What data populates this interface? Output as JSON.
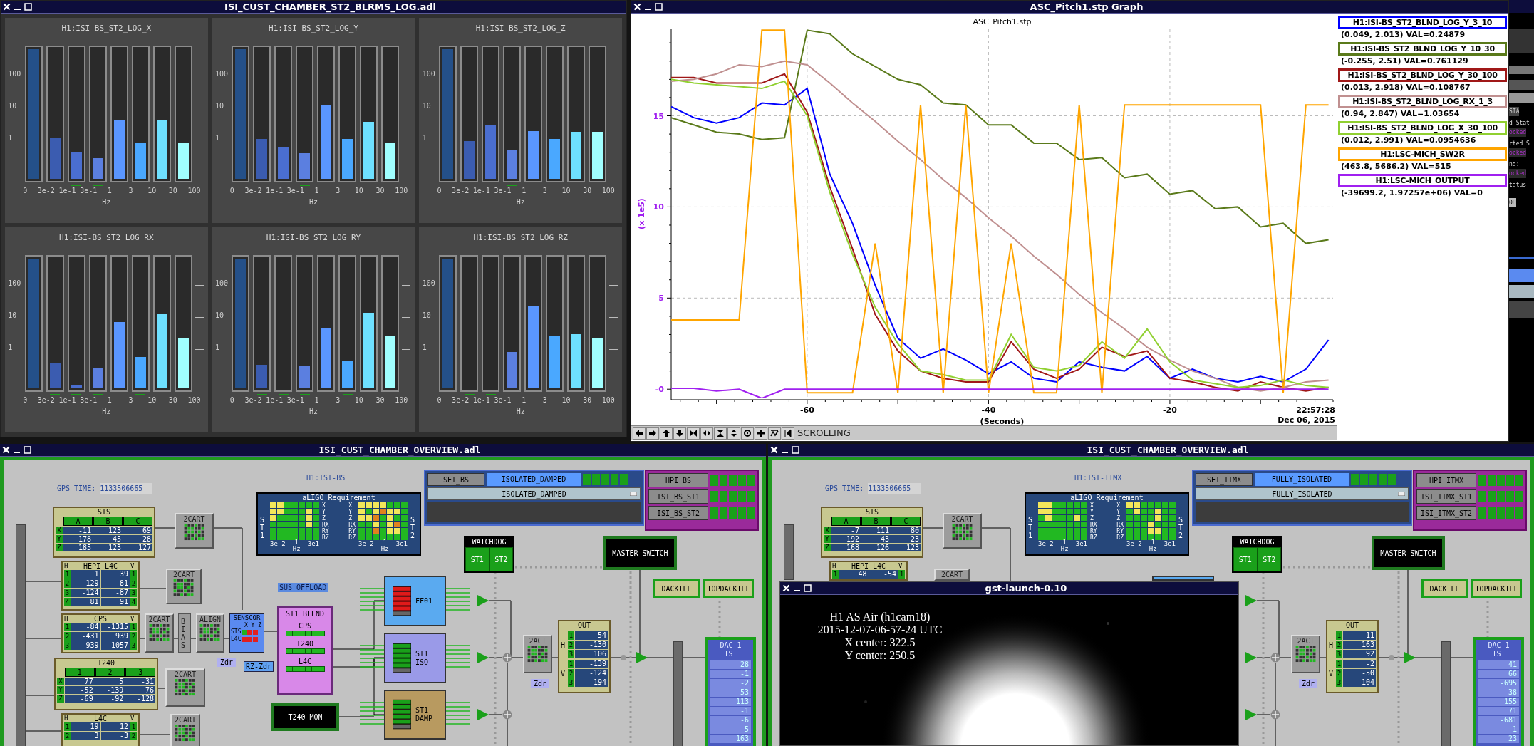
{
  "blrms_window": {
    "title": "ISI_CUST_CHAMBER_ST2_BLRMS_LOG.adl",
    "panels": [
      {
        "title": "H1:ISI-BS_ST2_LOG_X",
        "scale": [
          "100",
          "10",
          "1"
        ],
        "freqs": [
          "0",
          "3e-2",
          "1e-1",
          "3e-1",
          "1",
          "3",
          "10",
          "30",
          "100"
        ],
        "unit": "Hz",
        "bars": [
          {
            "level": 1,
            "color": "#245089",
            "marked": false
          },
          {
            "level": 0.32,
            "color": "#3b5cb0",
            "marked": false
          },
          {
            "level": 0.21,
            "color": "#4a6ed0",
            "marked": true
          },
          {
            "level": 0.16,
            "color": "#5b7fe0",
            "marked": true
          },
          {
            "level": 0.45,
            "color": "#5a96ff",
            "marked": false
          },
          {
            "level": 0.28,
            "color": "#4aa8ff",
            "marked": false
          },
          {
            "level": 0.45,
            "color": "#6ee0ff",
            "marked": false
          },
          {
            "level": 0.28,
            "color": "#a0ffff",
            "marked": false
          }
        ]
      },
      {
        "title": "H1:ISI-BS_ST2_LOG_Y",
        "scale": [
          "100",
          "10",
          "1"
        ],
        "freqs": [
          "0",
          "3e-2",
          "1e-1",
          "3e-1",
          "1",
          "3",
          "10",
          "30",
          "100"
        ],
        "unit": "Hz",
        "bars": [
          {
            "level": 1,
            "color": "#245089",
            "marked": false
          },
          {
            "level": 0.31,
            "color": "#3b5cb0",
            "marked": false
          },
          {
            "level": 0.25,
            "color": "#4a6ed0",
            "marked": false
          },
          {
            "level": 0.2,
            "color": "#5b7fe0",
            "marked": true
          },
          {
            "level": 0.57,
            "color": "#5a96ff",
            "marked": false
          },
          {
            "level": 0.31,
            "color": "#4aa8ff",
            "marked": false
          },
          {
            "level": 0.44,
            "color": "#6ee0ff",
            "marked": false
          },
          {
            "level": 0.28,
            "color": "#a0ffff",
            "marked": false
          }
        ]
      },
      {
        "title": "H1:ISI-BS_ST2_LOG_Z",
        "scale": [
          "100",
          "10",
          "1"
        ],
        "freqs": [
          "0",
          "3e-2",
          "1e-1",
          "3e-1",
          "1",
          "3",
          "10",
          "30",
          "100"
        ],
        "unit": "Hz",
        "bars": [
          {
            "level": 1,
            "color": "#245089",
            "marked": false
          },
          {
            "level": 0.29,
            "color": "#3b5cb0",
            "marked": false
          },
          {
            "level": 0.42,
            "color": "#4a6ed0",
            "marked": false
          },
          {
            "level": 0.22,
            "color": "#5b7fe0",
            "marked": true
          },
          {
            "level": 0.37,
            "color": "#5a96ff",
            "marked": false
          },
          {
            "level": 0.31,
            "color": "#4aa8ff",
            "marked": false
          },
          {
            "level": 0.36,
            "color": "#6ee0ff",
            "marked": false
          },
          {
            "level": 0.36,
            "color": "#a0ffff",
            "marked": false
          }
        ]
      },
      {
        "title": "H1:ISI-BS_ST2_LOG_RX",
        "scale": [
          "100",
          "10",
          "1"
        ],
        "freqs": [
          "0",
          "3e-2",
          "1e-1",
          "3e-1",
          "1",
          "3",
          "10",
          "30",
          "100"
        ],
        "unit": "Hz",
        "bars": [
          {
            "level": 1,
            "color": "#245089",
            "marked": false
          },
          {
            "level": 0.2,
            "color": "#3b5cb0",
            "marked": true
          },
          {
            "level": 0.02,
            "color": "#4a6ed0",
            "marked": true
          },
          {
            "level": 0.16,
            "color": "#5b7fe0",
            "marked": true
          },
          {
            "level": 0.51,
            "color": "#5a96ff",
            "marked": false
          },
          {
            "level": 0.24,
            "color": "#4aa8ff",
            "marked": true
          },
          {
            "level": 0.57,
            "color": "#6ee0ff",
            "marked": false
          },
          {
            "level": 0.39,
            "color": "#a0ffff",
            "marked": false
          }
        ]
      },
      {
        "title": "H1:ISI-BS_ST2_LOG_RY",
        "scale": [
          "100",
          "10",
          "1"
        ],
        "freqs": [
          "0",
          "3e-2",
          "1e-1",
          "3e-1",
          "1",
          "3",
          "10",
          "30",
          "100"
        ],
        "unit": "Hz",
        "bars": [
          {
            "level": 1,
            "color": "#245089",
            "marked": false
          },
          {
            "level": 0.18,
            "color": "#3b5cb0",
            "marked": true
          },
          {
            "marked": true
          },
          {
            "level": 0.17,
            "color": "#5b7fe0",
            "marked": true
          },
          {
            "level": 0.46,
            "color": "#5a96ff",
            "marked": false
          },
          {
            "level": 0.21,
            "color": "#4aa8ff",
            "marked": true
          },
          {
            "level": 0.58,
            "color": "#6ee0ff",
            "marked": false
          },
          {
            "level": 0.4,
            "color": "#a0ffff",
            "marked": false
          }
        ]
      },
      {
        "title": "H1:ISI-BS_ST2_LOG_RZ",
        "scale": [
          "100",
          "10",
          "1"
        ],
        "freqs": [
          "0",
          "3e-2",
          "1e-1",
          "3e-1",
          "1",
          "3",
          "10",
          "30",
          "100"
        ],
        "unit": "Hz",
        "bars": [
          {
            "level": 1,
            "color": "#245089",
            "marked": false
          },
          {
            "marked": true
          },
          {
            "marked": true
          },
          {
            "level": 0.28,
            "color": "#5b7fe0",
            "marked": false
          },
          {
            "level": 0.63,
            "color": "#5a96ff",
            "marked": false
          },
          {
            "level": 0.4,
            "color": "#4aa8ff",
            "marked": false
          },
          {
            "level": 0.42,
            "color": "#6ee0ff",
            "marked": false
          },
          {
            "level": 0.39,
            "color": "#a0ffff",
            "marked": false
          }
        ]
      }
    ]
  },
  "graph_window": {
    "title": "ASC_Pitch1.stp Graph",
    "time": "22:57:28",
    "date": "Dec 06, 2015",
    "mode": "SCROLLING",
    "chart_data": {
      "type": "line",
      "title": "ASC_Pitch1.stp",
      "xlabel": "(Seconds)",
      "ylabel": "(x 1e5)",
      "xlim": [
        -75,
        -2
      ],
      "ylim": [
        -0.5,
        19.75
      ],
      "grid": true,
      "xticks": [
        -60,
        -40,
        -20
      ],
      "yticks": [
        {
          "value": 0,
          "label": "-0"
        },
        5,
        10,
        15
      ],
      "x": [
        -75,
        -72.5,
        -70,
        -67.5,
        -65,
        -62.5,
        -60,
        -57.5,
        -55,
        -52.5,
        -50,
        -47.5,
        -45,
        -42.5,
        -40,
        -37.5,
        -35,
        -32.5,
        -30,
        -27.5,
        -25,
        -22.5,
        -20,
        -17.5,
        -15,
        -12.5,
        -10,
        -7.5,
        -5,
        -2.5
      ],
      "series": [
        {
          "name": "H1:ISI-BS_ST2_BLND_LOG_Y_3_10",
          "color": "#0000ff",
          "values": [
            15.5,
            14.9,
            14.6,
            14.9,
            15.7,
            15.6,
            16.5,
            11.8,
            9.1,
            5.7,
            2.8,
            1.7,
            2.2,
            1.6,
            0.85,
            1.5,
            0.6,
            0.4,
            1.5,
            1.2,
            1.0,
            1.8,
            0.6,
            1.1,
            0.6,
            0.4,
            0.7,
            0.4,
            1.1,
            2.7
          ]
        },
        {
          "name": "H1:ISI-BS_ST2_BLND_LOG_Y_10_30",
          "color": "#5a7a1a",
          "values": [
            14.9,
            14.5,
            14.1,
            14.0,
            13.7,
            13.8,
            19.7,
            19.5,
            18.4,
            17.7,
            17.0,
            16.7,
            15.7,
            15.6,
            14.5,
            14.5,
            13.5,
            13.5,
            12.6,
            12.7,
            11.6,
            11.8,
            10.7,
            10.9,
            9.9,
            10.0,
            8.9,
            9.1,
            8.0,
            8.2
          ]
        },
        {
          "name": "H1:ISI-BS_ST2_BLND_LOG_Y_30_100",
          "color": "#a01818",
          "values": [
            17.1,
            17.1,
            16.8,
            16.8,
            16.8,
            17.3,
            15.2,
            11.1,
            7.7,
            4.1,
            2.1,
            1.0,
            0.6,
            0.4,
            0.4,
            2.6,
            1.1,
            0.6,
            1.1,
            2.3,
            1.8,
            2.1,
            0.6,
            0.4,
            0.1,
            -0.1,
            0.4,
            0.1,
            -0.1,
            0.1
          ]
        },
        {
          "name": "H1:ISI-BS_ST2_BLND_LOG_RX_1_3",
          "color": "#c09090",
          "values": [
            16.9,
            17.0,
            17.3,
            17.8,
            17.7,
            18.0,
            17.8,
            16.8,
            15.7,
            14.7,
            13.6,
            12.6,
            11.5,
            10.5,
            9.4,
            8.4,
            7.3,
            6.3,
            5.2,
            4.2,
            3.3,
            2.3,
            1.6,
            1.0,
            0.6,
            0.1,
            -0.1,
            0.1,
            0.4,
            0.5
          ]
        },
        {
          "name": "H1:ISI-BS_ST2_BLND_LOG_X_30_100",
          "color": "#90d030",
          "values": [
            17.0,
            16.8,
            16.7,
            16.6,
            16.5,
            16.9,
            15.0,
            10.8,
            7.4,
            4.5,
            2.5,
            1.0,
            0.8,
            0.5,
            0.5,
            3.0,
            1.2,
            1.0,
            1.3,
            2.6,
            1.7,
            3.3,
            1.5,
            0.5,
            0.3,
            0.1,
            0.2,
            0.5,
            0.2,
            0.1
          ]
        },
        {
          "name": "H1:LSC-MICH_SW2R",
          "color": "#ffa500",
          "values": [
            3.8,
            3.8,
            3.8,
            3.8,
            19.7,
            19.7,
            -0.2,
            -0.2,
            -0.2,
            8,
            -0.2,
            15.6,
            -0.2,
            15.6,
            -0.2,
            8,
            -0.2,
            -0.2,
            15.6,
            -0.2,
            15.6,
            15.6,
            15.6,
            15.6,
            15.6,
            15.6,
            15.6,
            -0.2,
            15.6,
            15.6
          ]
        },
        {
          "name": "H1:LSC-MICH_OUTPUT",
          "color": "#a020f0",
          "values": [
            0.05,
            0.05,
            -0.1,
            0,
            -0.5,
            0,
            0,
            0,
            0,
            0,
            0,
            0,
            0,
            0,
            0,
            0,
            0,
            0,
            0,
            0,
            0,
            0,
            0,
            0,
            0,
            0,
            0,
            0,
            0,
            0
          ]
        }
      ]
    },
    "readings": [
      "(0.049, 2.013) VAL=0.24879",
      "(-0.255, 2.51) VAL=0.761129",
      "(0.013, 2.918) VAL=0.108767",
      "(0.94, 2.847) VAL=1.03654",
      "(0.012, 2.991) VAL=0.0954636",
      "(463.8, 5686.2) VAL=515",
      "(-39699.2, 1.97257e+06) VAL=0"
    ]
  },
  "background_window": {
    "fragments": [
      {
        "text": "STA",
        "kind": "heading"
      },
      {
        "text": "d Stat",
        "kind": "label"
      },
      {
        "text": "ocked",
        "kind": "status"
      },
      {
        "text": "rted S",
        "kind": "label"
      },
      {
        "text": "ocked",
        "kind": "status"
      },
      {
        "text": "nd:",
        "kind": "label"
      },
      {
        "text": "ocked",
        "kind": "status"
      },
      {
        "text": "tatus",
        "kind": "label"
      },
      {
        "text": "0H",
        "kind": "field"
      }
    ]
  },
  "overview_windows": [
    {
      "title": "ISI_CUST_CHAMBER_OVERVIEW.adl",
      "gps_label": "GPS TIME:",
      "gps_time": "1133506665",
      "chamber": "H1:ISI-BS",
      "sts": {
        "title": "STS",
        "columns": [
          "A",
          "B",
          "C"
        ],
        "rows": [
          {
            "label": "X",
            "values": [
              "-11",
              "123",
              "69"
            ]
          },
          {
            "label": "Y",
            "values": [
              "178",
              "45",
              "28"
            ]
          },
          {
            "label": "Z",
            "values": [
              "185",
              "123",
              "127"
            ]
          }
        ]
      },
      "carts": [
        "2CART",
        "2CART",
        "2CART",
        "2CART",
        "2CART"
      ],
      "hepi": {
        "title": "HEPI L4C",
        "left": "H",
        "right": "V",
        "rows": [
          [
            "1",
            "1",
            "39",
            "1"
          ],
          [
            "2",
            "-129",
            "-81",
            "2"
          ],
          [
            "3",
            "-124",
            "-87",
            "3"
          ],
          [
            "4",
            "81",
            "91",
            "4"
          ]
        ]
      },
      "cps": {
        "title": "CPS",
        "left": "H",
        "right": "V",
        "rows": [
          [
            "1",
            "-84",
            "-1315",
            "1"
          ],
          [
            "2",
            "-431",
            "939",
            "2"
          ],
          [
            "3",
            "-939",
            "-1057",
            "3"
          ]
        ]
      },
      "bias": "BIAS",
      "align": "ALIGN",
      "senscor": {
        "title": "SENSCOR",
        "axes": "X Y Z",
        "rows": [
          {
            "label": "STS",
            "cells": [
              {
                "color": "#20b020"
              },
              {
                "color": "#e02020"
              },
              {
                "color": "#e02020"
              }
            ]
          },
          {
            "label": "L4C",
            "cells": [
              {
                "color": "#e02020"
              },
              {
                "color": "#e02020"
              },
              {
                "color": "#e02020"
              }
            ]
          }
        ]
      },
      "t240": {
        "title": "T240",
        "columns": [
          "1",
          "2",
          "3"
        ],
        "rows": [
          {
            "label": "X",
            "values": [
              "77",
              "5",
              "-31"
            ]
          },
          {
            "label": "Y",
            "values": [
              "-52",
              "-139",
              "76"
            ]
          },
          {
            "label": "Z",
            "values": [
              "-69",
              "-92",
              "-128"
            ]
          }
        ]
      },
      "l4c": {
        "title": "L4C",
        "left": "H",
        "right": "V",
        "rows": [
          [
            "1",
            "-19",
            "12",
            "1"
          ],
          [
            "2",
            "3",
            "-3",
            "2"
          ]
        ]
      },
      "tags": [
        "Zdr",
        "RZ-Zdr"
      ],
      "sus_offload": "SUS OFFLOAD",
      "blend": {
        "title": "ST1 BLEND",
        "rows": [
          "CPS",
          "T240",
          "L4C"
        ]
      },
      "t240_mon": "T240 MON",
      "requirement": {
        "title": "aLIGO Requirement",
        "grids": [
          {
            "stage": "ST1",
            "dofs": [
              "X",
              "Y",
              "Z",
              "RX",
              "RY",
              "RZ"
            ],
            "ticks": [
              "3e-2",
              "1",
              "Hz",
              "3e1"
            ],
            "cells": [
              [
                {
                  "color": "#f2e65a"
                },
                {
                  "color": "#f2e65a"
                },
                {
                  "color": "#22b822"
                },
                {
                  "color": "#22b822"
                },
                {
                  "color": "#22b822"
                },
                {
                  "color": "#22b822"
                },
                {
                  "color": "#22b822"
                }
              ],
              [
                {
                  "color": "#f2e65a"
                },
                {
                  "color": "#f2e65a"
                },
                {
                  "color": "#22b822"
                },
                {
                  "color": "#22b822"
                },
                {
                  "color": "#22b822"
                },
                {
                  "color": "#f2e65a"
                },
                {
                  "color": "#22b822"
                }
              ],
              [
                {
                  "color": "#f2e65a"
                },
                {
                  "color": "#22b822"
                },
                {
                  "color": "#22b822"
                },
                {
                  "color": "#22b822"
                },
                {
                  "color": "#22b822"
                },
                {
                  "color": "#f2e65a"
                },
                {
                  "color": "#22b822"
                }
              ],
              [
                {
                  "color": "#22b822"
                },
                {
                  "color": "#22b822"
                },
                {
                  "color": "#22b822"
                },
                {
                  "color": "#22b822"
                },
                {
                  "color": "#22b822"
                },
                {
                  "color": "#f2e65a"
                },
                {
                  "color": "#22b822"
                }
              ],
              [
                {
                  "color": "#22b822"
                },
                {
                  "color": "#22b822"
                },
                {
                  "color": "#22b822"
                },
                {
                  "color": "#22b822"
                },
                {
                  "color": "#22b822"
                },
                {
                  "color": "#22b822"
                },
                {
                  "color": "#22b822"
                }
              ],
              [
                {
                  "color": "#22b822"
                },
                {
                  "color": "#22b822"
                },
                {
                  "color": "#22b822"
                },
                {
                  "color": "#22b822"
                },
                {
                  "color": "#22b822"
                },
                {
                  "color": "#22b822"
                },
                {
                  "color": "#22b822"
                }
              ]
            ]
          },
          {
            "stage": "ST2",
            "dofs": [
              "X",
              "Y",
              "Z",
              "RX",
              "RY",
              "RZ"
            ],
            "ticks": [
              "3e-2",
              "1",
              "Hz",
              "3e1"
            ],
            "cells": [
              [
                {
                  "color": "#f2e65a"
                },
                {
                  "color": "#f2e65a"
                },
                {
                  "color": "#f2e65a"
                },
                {
                  "color": "#f2e65a"
                },
                {
                  "color": "#22b822"
                },
                {
                  "color": "#22b822"
                },
                {
                  "color": "#22b822"
                }
              ],
              [
                {
                  "color": "#f2e65a"
                },
                {
                  "color": "#22b822"
                },
                {
                  "color": "#f2e65a"
                },
                {
                  "color": "#e0821e"
                },
                {
                  "color": "#f2e65a"
                },
                {
                  "color": "#f2e65a"
                },
                {
                  "color": "#22b822"
                }
              ],
              [
                {
                  "color": "#f2e65a"
                },
                {
                  "color": "#f2e65a"
                },
                {
                  "color": "#e0821e"
                },
                {
                  "color": "#22b822"
                },
                {
                  "color": "#f2e65a"
                },
                {
                  "color": "#22b822"
                },
                {
                  "color": "#22b822"
                }
              ],
              [
                {
                  "color": "#22b822"
                },
                {
                  "color": "#22b822"
                },
                {
                  "color": "#f2e65a"
                },
                {
                  "color": "#22b822"
                },
                {
                  "color": "#f2e65a"
                },
                {
                  "color": "#e0821e"
                },
                {
                  "color": "#22b822"
                }
              ],
              [
                {
                  "color": "#22b822"
                },
                {
                  "color": "#22b822"
                },
                {
                  "color": "#e0821e"
                },
                {
                  "color": "#22b822"
                },
                {
                  "color": "#f2e65a"
                },
                {
                  "color": "#f2e65a"
                },
                {
                  "color": "#22b822"
                }
              ],
              [
                {
                  "color": "#22b822"
                },
                {
                  "color": "#22b822"
                },
                {
                  "color": "#22b822"
                },
                {
                  "color": "#22b822"
                },
                {
                  "color": "#22b822"
                },
                {
                  "color": "#22b822"
                },
                {
                  "color": "#22b822"
                }
              ]
            ]
          }
        ]
      },
      "guardian": {
        "node": "SEI_BS",
        "state": "ISOLATED_DAMPED",
        "lights": [
          {
            "color": "#1aa01a"
          },
          {
            "color": "#1aa01a"
          },
          {
            "color": "#1aa01a"
          },
          {
            "color": "#1aa01a"
          },
          {
            "color": "#1aa01a"
          }
        ],
        "request": "ISOLATED_DAMPED"
      },
      "subsystems": [
        {
          "label": "HPI_BS",
          "lights": [
            {
              "color": "#1aa01a"
            },
            {
              "color": "#1aa01a"
            },
            {
              "color": "#1aa01a"
            },
            {
              "color": "#1aa01a"
            },
            {
              "color": "#1aa01a"
            }
          ]
        },
        {
          "label": "ISI_BS_ST1",
          "lights": [
            {
              "color": "#1aa01a"
            },
            {
              "color": "#1aa01a"
            },
            {
              "color": "#1aa01a"
            },
            {
              "color": "#1aa01a"
            },
            {
              "color": "#1aa01a"
            }
          ]
        },
        {
          "label": "ISI_BS_ST2",
          "lights": [
            {
              "color": "#1aa01a"
            },
            {
              "color": "#1aa01a"
            },
            {
              "color": "#1aa01a"
            },
            {
              "color": "#1aa01a"
            },
            {
              "color": "#1aa01a"
            }
          ]
        }
      ],
      "watchdog": {
        "title": "WATCHDOG",
        "stages": [
          "ST1",
          "ST2"
        ]
      },
      "master_switch": "MASTER SWITCH",
      "kill_buttons": [
        "DACKILL",
        "IOPDACKILL"
      ],
      "filters": [
        {
          "kind": "ff",
          "label": "FF01"
        },
        {
          "kind": "iso",
          "label": "ST1 ISO"
        },
        {
          "kind": "damp",
          "label": "ST1 DAMP"
        }
      ],
      "act": "2ACT",
      "act_tag": "Zdr",
      "out": {
        "title": "OUT",
        "groups": [
          {
            "label": "H",
            "rows": [
              [
                "1",
                "-54"
              ],
              [
                "2",
                "-130"
              ],
              [
                "3",
                "106"
              ]
            ]
          },
          {
            "label": "V",
            "rows": [
              [
                "1",
                "-139"
              ],
              [
                "2",
                "-124"
              ],
              [
                "3",
                "-194"
              ]
            ]
          }
        ]
      },
      "dac": {
        "title": "DAC 1",
        "subtitle": "ISI",
        "values": [
          "28",
          "-1",
          "-2",
          "-53",
          "113",
          "-1",
          "-6",
          "5",
          "163"
        ]
      }
    },
    {
      "title": "ISI_CUST_CHAMBER_OVERVIEW.adl",
      "gps_label": "GPS TIME:",
      "gps_time": "1133506665",
      "chamber": "H1:ISI-ITMX",
      "sts": {
        "title": "STS",
        "columns": [
          "A",
          "B",
          "C"
        ],
        "rows": [
          {
            "label": "X",
            "values": [
              "-7",
              "111",
              "80"
            ]
          },
          {
            "label": "Y",
            "values": [
              "192",
              "43",
              "23"
            ]
          },
          {
            "label": "Z",
            "values": [
              "168",
              "126",
              "123"
            ]
          }
        ]
      },
      "carts": [
        "2CART",
        "2CART"
      ],
      "hepi": {
        "title": "HEPI L4C",
        "left": "H",
        "right": "V",
        "rows": [
          [
            "1",
            "48",
            "-54",
            "1"
          ]
        ]
      },
      "requirement": {
        "title": "aLIGO Requirement",
        "grids": [
          {
            "stage": "ST1",
            "dofs": [
              "X",
              "Y",
              "Z",
              "RX",
              "RY",
              "RZ"
            ],
            "ticks": [
              "3e-2",
              "1",
              "Hz",
              "3e1"
            ],
            "cells": [
              [
                {
                  "color": "#f2e65a"
                },
                {
                  "color": "#f2e65a"
                },
                {
                  "color": "#22b822"
                },
                {
                  "color": "#22b822"
                },
                {
                  "color": "#22b822"
                },
                {
                  "color": "#22b822"
                },
                {
                  "color": "#22b822"
                }
              ],
              [
                {
                  "color": "#f2e65a"
                },
                {
                  "color": "#f2e65a"
                },
                {
                  "color": "#22b822"
                },
                {
                  "color": "#22b822"
                },
                {
                  "color": "#22b822"
                },
                {
                  "color": "#22b822"
                },
                {
                  "color": "#22b822"
                }
              ],
              [
                {
                  "color": "#22b822"
                },
                {
                  "color": "#f2e65a"
                },
                {
                  "color": "#22b822"
                },
                {
                  "color": "#22b822"
                },
                {
                  "color": "#22b822"
                },
                {
                  "color": "#f2e65a"
                },
                {
                  "color": "#22b822"
                }
              ],
              [
                {
                  "color": "#22b822"
                },
                {
                  "color": "#22b822"
                },
                {
                  "color": "#22b822"
                },
                {
                  "color": "#22b822"
                },
                {
                  "color": "#22b822"
                },
                {
                  "color": "#22b822"
                },
                {
                  "color": "#22b822"
                }
              ],
              [
                {
                  "color": "#22b822"
                },
                {
                  "color": "#22b822"
                },
                {
                  "color": "#22b822"
                },
                {
                  "color": "#22b822"
                },
                {
                  "color": "#22b822"
                },
                {
                  "color": "#22b822"
                },
                {
                  "color": "#22b822"
                }
              ],
              [
                {
                  "color": "#22b822"
                },
                {
                  "color": "#22b822"
                },
                {
                  "color": "#22b822"
                },
                {
                  "color": "#22b822"
                },
                {
                  "color": "#22b822"
                },
                {
                  "color": "#22b822"
                },
                {
                  "color": "#22b822"
                }
              ]
            ]
          },
          {
            "stage": "ST2",
            "dofs": [
              "X",
              "Y",
              "Z",
              "RX",
              "RY",
              "RZ"
            ],
            "ticks": [
              "3e-2",
              "1",
              "Hz",
              "3e1"
            ],
            "cells": [
              [
                {
                  "color": "#f2e65a"
                },
                {
                  "color": "#f2e65a"
                },
                {
                  "color": "#22b822"
                },
                {
                  "color": "#22b822"
                },
                {
                  "color": "#22b822"
                },
                {
                  "color": "#22b822"
                },
                {
                  "color": "#22b822"
                }
              ],
              [
                {
                  "color": "#22b822"
                },
                {
                  "color": "#f2e65a"
                },
                {
                  "color": "#22b822"
                },
                {
                  "color": "#22b822"
                },
                {
                  "color": "#f2e65a"
                },
                {
                  "color": "#22b822"
                },
                {
                  "color": "#22b822"
                }
              ],
              [
                {
                  "color": "#22b822"
                },
                {
                  "color": "#22b822"
                },
                {
                  "color": "#22b822"
                },
                {
                  "color": "#22b822"
                },
                {
                  "color": "#f2e65a"
                },
                {
                  "color": "#22b822"
                },
                {
                  "color": "#22b822"
                }
              ],
              [
                {
                  "color": "#22b822"
                },
                {
                  "color": "#22b822"
                },
                {
                  "color": "#22b822"
                },
                {
                  "color": "#f2e65a"
                },
                {
                  "color": "#22b822"
                },
                {
                  "color": "#22b822"
                },
                {
                  "color": "#22b822"
                }
              ],
              [
                {
                  "color": "#22b822"
                },
                {
                  "color": "#22b822"
                },
                {
                  "color": "#22b822"
                },
                {
                  "color": "#f2e65a"
                },
                {
                  "color": "#f2e65a"
                },
                {
                  "color": "#22b822"
                },
                {
                  "color": "#22b822"
                }
              ],
              [
                {
                  "color": "#22b822"
                },
                {
                  "color": "#22b822"
                },
                {
                  "color": "#22b822"
                },
                {
                  "color": "#22b822"
                },
                {
                  "color": "#22b822"
                },
                {
                  "color": "#22b822"
                },
                {
                  "color": "#22b822"
                }
              ]
            ]
          }
        ]
      },
      "guardian": {
        "node": "SEI_ITMX",
        "state": "FULLY_ISOLATED",
        "lights": [
          {
            "color": "#1aa01a"
          },
          {
            "color": "#1aa01a"
          },
          {
            "color": "#1aa01a"
          },
          {
            "color": "#1aa01a"
          },
          {
            "color": "#1aa01a"
          }
        ],
        "request": "FULLY_ISOLATED"
      },
      "subsystems": [
        {
          "label": "HPI_ITMX",
          "lights": [
            {
              "color": "#1aa01a"
            },
            {
              "color": "#1aa01a"
            },
            {
              "color": "#1aa01a"
            },
            {
              "color": "#1aa01a"
            },
            {
              "color": "#1aa01a"
            }
          ]
        },
        {
          "label": "ISI_ITMX_ST1",
          "lights": [
            {
              "color": "#1aa01a"
            },
            {
              "color": "#1aa01a"
            },
            {
              "color": "#1aa01a"
            },
            {
              "color": "#1aa01a"
            },
            {
              "color": "#1aa01a"
            }
          ]
        },
        {
          "label": "ISI_ITMX_ST2",
          "lights": [
            {
              "color": "#1aa01a"
            },
            {
              "color": "#1aa01a"
            },
            {
              "color": "#1aa01a"
            },
            {
              "color": "#1aa01a"
            },
            {
              "color": "#1aa01a"
            }
          ]
        }
      ],
      "watchdog": {
        "title": "WATCHDOG",
        "stages": [
          "ST1",
          "ST2"
        ]
      },
      "master_switch": "MASTER SWITCH",
      "kill_buttons": [
        "DACKILL",
        "IOPDACKILL"
      ],
      "filters": [
        {
          "kind": "ff"
        }
      ],
      "act": "2ACT",
      "act_tag": "Zdr",
      "out": {
        "title": "OUT",
        "groups": [
          {
            "label": "H",
            "rows": [
              [
                "1",
                "11"
              ],
              [
                "2",
                "163"
              ],
              [
                "3",
                "92"
              ]
            ]
          },
          {
            "label": "V",
            "rows": [
              [
                "1",
                "-2"
              ],
              [
                "2",
                "-50"
              ],
              [
                "3",
                "-104"
              ]
            ]
          }
        ]
      },
      "dac": {
        "title": "DAC 1",
        "subtitle": "ISI",
        "values": [
          "41",
          "66",
          "-695",
          "38",
          "155",
          "71",
          "-681",
          "1",
          "23"
        ]
      }
    }
  ],
  "camera_window": {
    "title": "gst-launch-0.10",
    "overlay": [
      "H1 AS Air (h1cam18)",
      "2015-12-07-06-57-24 UTC",
      "X center: 322.5",
      "Y center: 250.5"
    ]
  }
}
